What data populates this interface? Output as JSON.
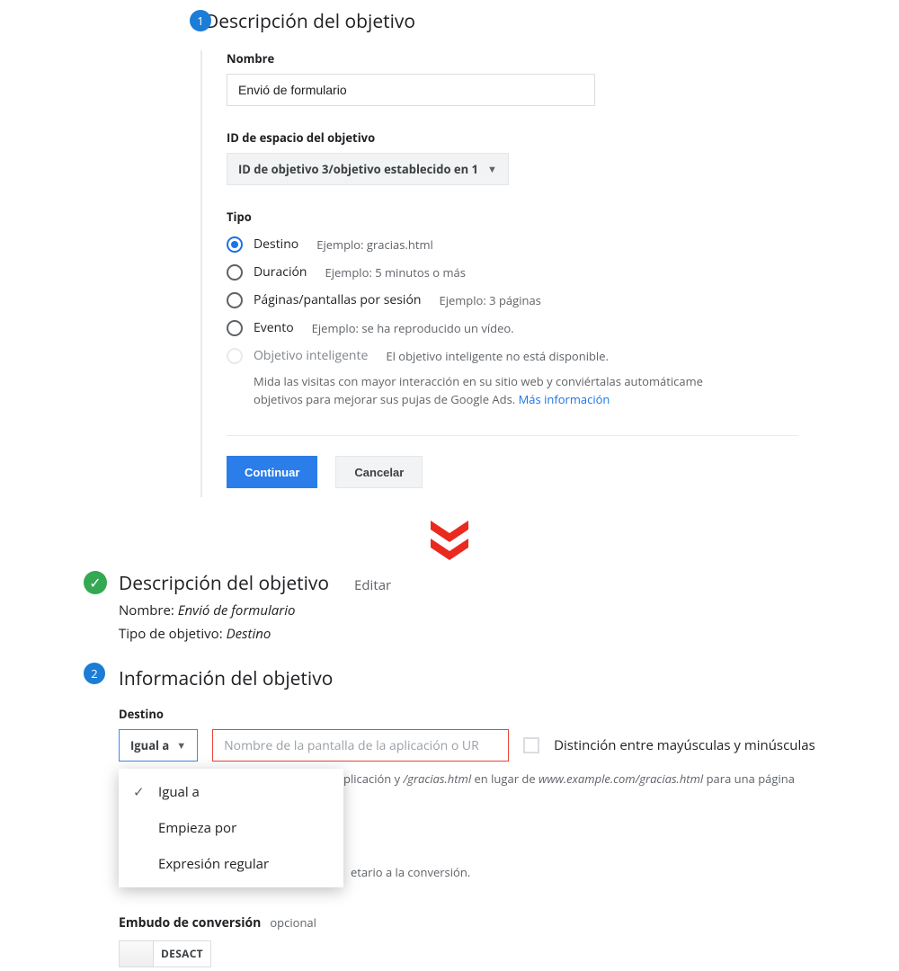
{
  "step1": {
    "badge": "1",
    "title": "Descripción del objetivo",
    "name_label": "Nombre",
    "name_value": "Envió de formulario",
    "slot_label": "ID de espacio del objetivo",
    "slot_value": "ID de objetivo 3/objetivo establecido en 1",
    "type_label": "Tipo",
    "options": [
      {
        "label": "Destino",
        "example": "Ejemplo: gracias.html",
        "checked": true,
        "disabled": false
      },
      {
        "label": "Duración",
        "example": "Ejemplo: 5 minutos o más",
        "checked": false,
        "disabled": false
      },
      {
        "label": "Páginas/pantallas por sesión",
        "example": "Ejemplo: 3 páginas",
        "checked": false,
        "disabled": false
      },
      {
        "label": "Evento",
        "example": "Ejemplo: se ha reproducido un vídeo.",
        "checked": false,
        "disabled": false
      },
      {
        "label": "Objetivo inteligente",
        "example": "El objetivo inteligente no está disponible.",
        "checked": false,
        "disabled": true
      }
    ],
    "smart_desc_1": "Mida las visitas con mayor interacción en su sitio web y conviértalas automáticame objetivos para mejorar sus pujas de Google Ads.",
    "smart_link": "Más información",
    "continue": "Continuar",
    "cancel": "Cancelar"
  },
  "step2": {
    "summary_title": "Descripción del objetivo",
    "edit": "Editar",
    "name_label": "Nombre:",
    "name_value": "Envió de formulario",
    "type_label": "Tipo de objetivo:",
    "type_value": "Destino",
    "badge": "2",
    "title": "Información del objetivo",
    "dest_label": "Destino",
    "match_selected": "Igual a",
    "match_options": [
      "Igual a",
      "Empieza por",
      "Expresión regular"
    ],
    "dest_placeholder": "Nombre de la pantalla de la aplicación o UR",
    "case_label": "Distinción entre mayúsculas y minúsculas",
    "hint_mid": "plicación y ",
    "hint_ital1": "/gracias.html",
    "hint_mid2": " en lugar de ",
    "hint_ital2": "www.example.com/gracias.html",
    "hint_end": " para una página",
    "bg_hint_tail": "etario a la conversión.",
    "funnel_label": "Embudo de conversión",
    "optional": "opcional",
    "toggle_text": "DESACT"
  }
}
